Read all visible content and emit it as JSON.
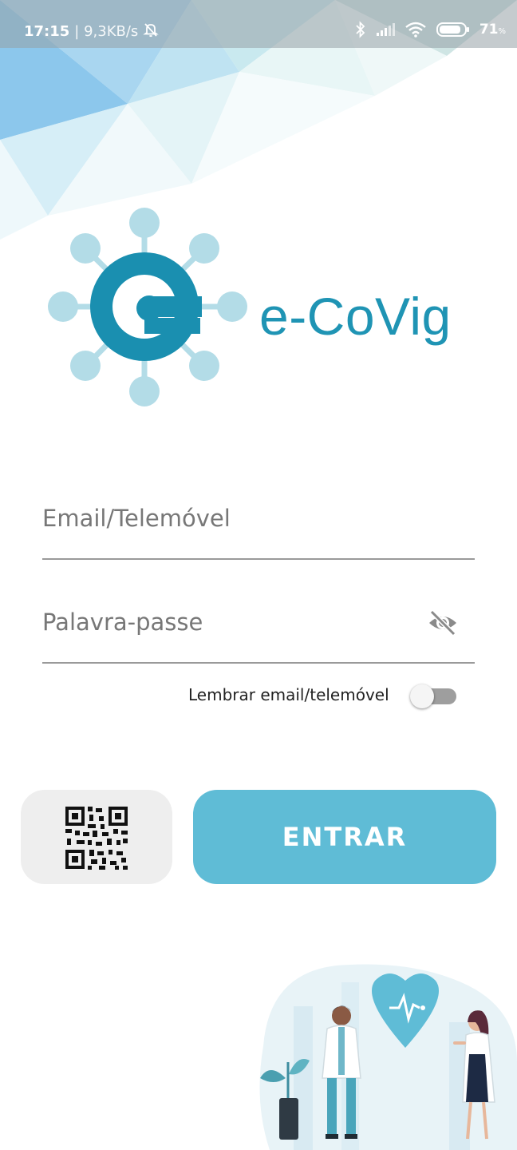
{
  "status_bar": {
    "time": "17:15",
    "network_speed": "| 9,3KB/s",
    "battery_percent": "71",
    "battery_unit": "%",
    "icons": [
      "bell-off-icon",
      "bluetooth-icon",
      "signal-icon",
      "wifi-icon",
      "battery-icon"
    ]
  },
  "logo": {
    "text": "e-CoVig"
  },
  "form": {
    "email_placeholder": "Email/Telemóvel",
    "password_placeholder": "Palavra-passe",
    "remember_label": "Lembrar email/telemóvel",
    "remember_enabled": false
  },
  "actions": {
    "qr_icon": "qr-code-icon",
    "enter_label": "ENTRAR"
  },
  "colors": {
    "brand": "#1f94b4",
    "brand_light": "#b3dce7",
    "button": "#5fbcd6",
    "qr_button_bg": "#eeeeee"
  }
}
